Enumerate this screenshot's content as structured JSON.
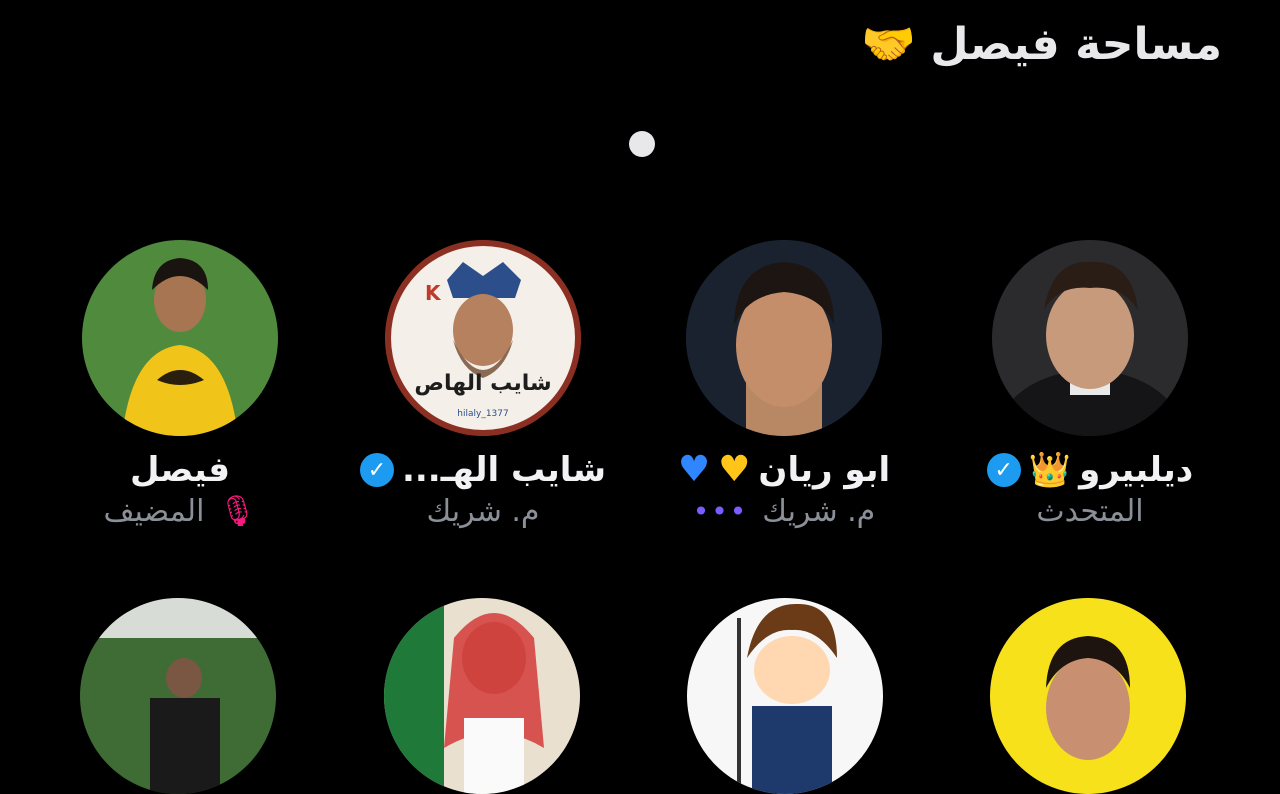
{
  "space": {
    "title": "مساحة فيصل",
    "title_emoji": "🤝"
  },
  "participants_row1": [
    {
      "name": "ديلبيرو",
      "role": "المتحدث",
      "badges": [
        "crown",
        "verified"
      ]
    },
    {
      "name": "ابو ريان",
      "role": "م. شريك",
      "badges": [
        "yellow-heart",
        "blue-heart"
      ],
      "status_icon": "speaking-dots"
    },
    {
      "name": "شايب الهـ...",
      "role": "م. شريك",
      "badges": [
        "verified"
      ],
      "avatar_caption": "شايب الهاص",
      "avatar_handle": "hilaly_1377",
      "avatar_letter": "K"
    },
    {
      "name": "فيصل",
      "role": "المضيف",
      "status_icon": "mic-off"
    }
  ],
  "icons": {
    "verified": "✓",
    "crown": "👑",
    "yellow_heart": "♥",
    "blue_heart": "♥",
    "dots": "•••",
    "mic_off": "🎙",
    "hand": "🤝"
  },
  "colors": {
    "background": "#000000",
    "verified": "#1d9bf0",
    "host_mic": "#f91880",
    "speaking_dots": "#7c5cff"
  }
}
